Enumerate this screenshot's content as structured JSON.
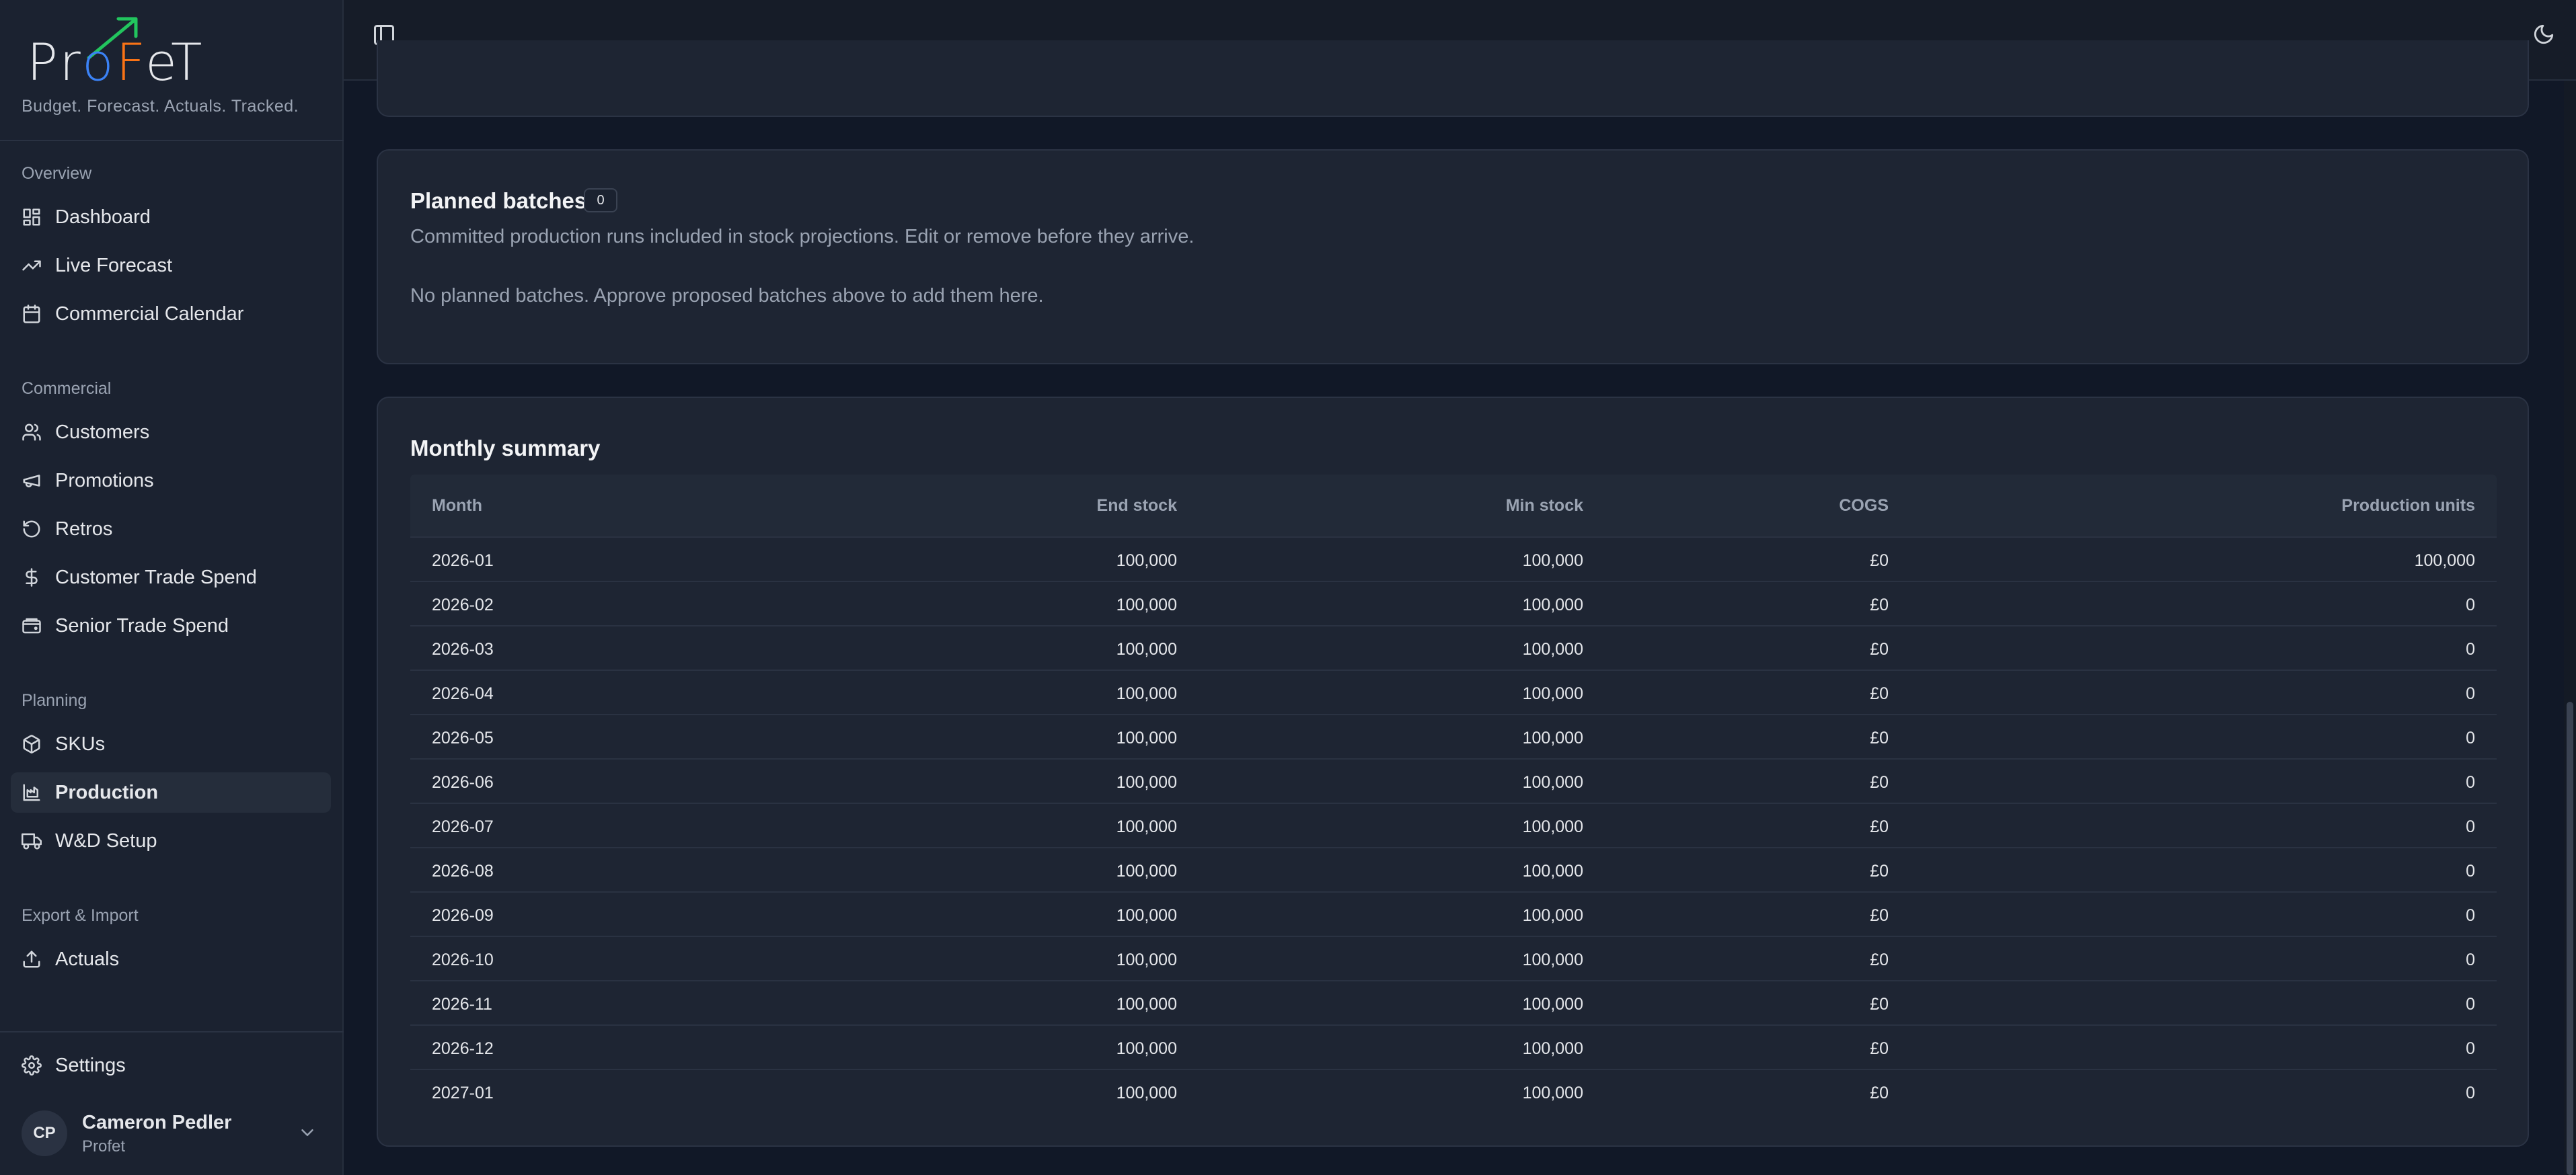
{
  "brand": {
    "logo_parts": [
      "Pr",
      "o",
      "F",
      "eT"
    ],
    "tagline": "Budget. Forecast. Actuals. Tracked."
  },
  "sidebar": {
    "sections": [
      {
        "label": "Overview",
        "items": [
          {
            "label": "Dashboard",
            "icon": "dashboard-icon"
          },
          {
            "label": "Live Forecast",
            "icon": "trending-up-icon"
          },
          {
            "label": "Commercial Calendar",
            "icon": "calendar-icon"
          }
        ]
      },
      {
        "label": "Commercial",
        "items": [
          {
            "label": "Customers",
            "icon": "users-icon"
          },
          {
            "label": "Promotions",
            "icon": "megaphone-icon"
          },
          {
            "label": "Retros",
            "icon": "rotate-icon"
          },
          {
            "label": "Customer Trade Spend",
            "icon": "dollar-icon"
          },
          {
            "label": "Senior Trade Spend",
            "icon": "wallet-icon"
          }
        ]
      },
      {
        "label": "Planning",
        "items": [
          {
            "label": "SKUs",
            "icon": "box-icon"
          },
          {
            "label": "Production",
            "icon": "factory-icon",
            "active": true
          },
          {
            "label": "W&D Setup",
            "icon": "truck-icon"
          }
        ]
      },
      {
        "label": "Export & Import",
        "items": [
          {
            "label": "Actuals",
            "icon": "upload-icon"
          }
        ]
      }
    ],
    "settings_label": "Settings",
    "user": {
      "initials": "CP",
      "name": "Cameron Pedler",
      "org": "Profet"
    }
  },
  "planned": {
    "title": "Planned batches",
    "count": "0",
    "description": "Committed production runs included in stock projections. Edit or remove before they arrive.",
    "empty_text": "No planned batches. Approve proposed batches above to add them here."
  },
  "monthly": {
    "title": "Monthly summary",
    "columns": {
      "month": "Month",
      "end_stock": "End stock",
      "min_stock": "Min stock",
      "cogs": "COGS",
      "production": "Production units"
    },
    "rows": [
      {
        "month": "2026-01",
        "end_stock": "100,000",
        "min_stock": "100,000",
        "cogs": "£0",
        "production": "100,000"
      },
      {
        "month": "2026-02",
        "end_stock": "100,000",
        "min_stock": "100,000",
        "cogs": "£0",
        "production": "0"
      },
      {
        "month": "2026-03",
        "end_stock": "100,000",
        "min_stock": "100,000",
        "cogs": "£0",
        "production": "0"
      },
      {
        "month": "2026-04",
        "end_stock": "100,000",
        "min_stock": "100,000",
        "cogs": "£0",
        "production": "0"
      },
      {
        "month": "2026-05",
        "end_stock": "100,000",
        "min_stock": "100,000",
        "cogs": "£0",
        "production": "0"
      },
      {
        "month": "2026-06",
        "end_stock": "100,000",
        "min_stock": "100,000",
        "cogs": "£0",
        "production": "0"
      },
      {
        "month": "2026-07",
        "end_stock": "100,000",
        "min_stock": "100,000",
        "cogs": "£0",
        "production": "0"
      },
      {
        "month": "2026-08",
        "end_stock": "100,000",
        "min_stock": "100,000",
        "cogs": "£0",
        "production": "0"
      },
      {
        "month": "2026-09",
        "end_stock": "100,000",
        "min_stock": "100,000",
        "cogs": "£0",
        "production": "0"
      },
      {
        "month": "2026-10",
        "end_stock": "100,000",
        "min_stock": "100,000",
        "cogs": "£0",
        "production": "0"
      },
      {
        "month": "2026-11",
        "end_stock": "100,000",
        "min_stock": "100,000",
        "cogs": "£0",
        "production": "0"
      },
      {
        "month": "2026-12",
        "end_stock": "100,000",
        "min_stock": "100,000",
        "cogs": "£0",
        "production": "0"
      },
      {
        "month": "2027-01",
        "end_stock": "100,000",
        "min_stock": "100,000",
        "cogs": "£0",
        "production": "0"
      }
    ]
  },
  "icons": {
    "sidebar_toggle": "sidebar-toggle-icon",
    "theme": "moon-icon"
  }
}
